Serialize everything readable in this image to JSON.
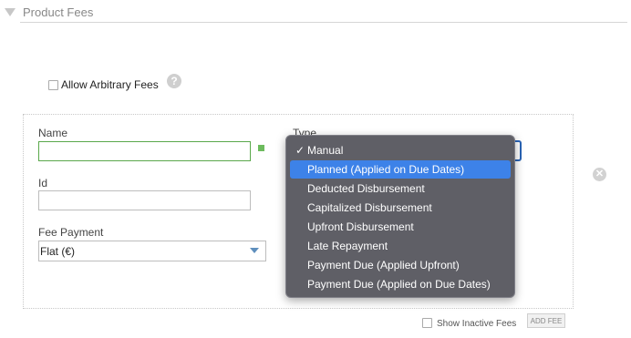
{
  "section": {
    "title": "Product Fees"
  },
  "allow_arbitrary": {
    "label": "Allow Arbitrary Fees",
    "checked": false,
    "help_icon": "?"
  },
  "fee_form": {
    "name_label": "Name",
    "name_value": "",
    "type_label": "Type",
    "id_label": "Id",
    "id_value": "",
    "payment_label": "Fee Payment",
    "payment_value": "Flat (€)",
    "remove_icon": "✕"
  },
  "type_menu": {
    "checked_index": 0,
    "highlighted_index": 1,
    "options": [
      "Manual",
      "Planned (Applied on Due Dates)",
      "Deducted Disbursement",
      "Capitalized Disbursement",
      "Upfront Disbursement",
      "Late Repayment",
      "Payment Due (Applied Upfront)",
      "Payment Due (Applied on Due Dates)"
    ]
  },
  "footer": {
    "show_inactive_label": "Show Inactive Fees",
    "add_fee_label": "ADD FEE"
  },
  "colors": {
    "menu_bg": "#5f5f66",
    "menu_highlight": "#3d82e8",
    "valid_green": "#6dbb5e",
    "focus_blue": "#2a64b6"
  }
}
